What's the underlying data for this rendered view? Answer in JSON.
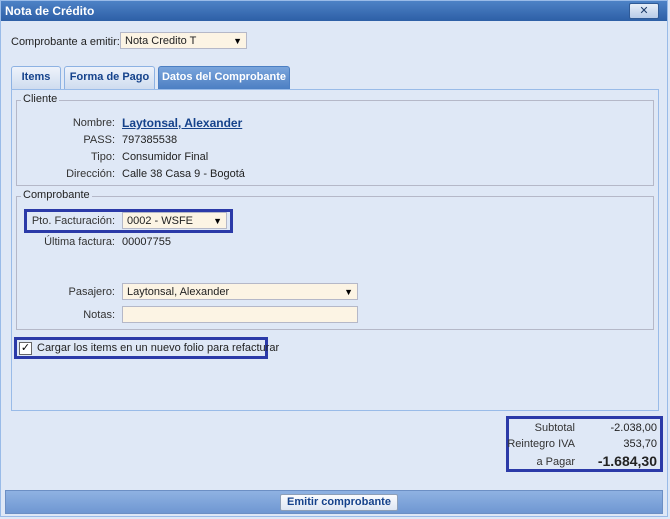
{
  "window": {
    "title": "Nota de Crédito",
    "close_label": "✕"
  },
  "comprobante_emitir": {
    "label": "Comprobante a emitir:",
    "value": "Nota Credito T"
  },
  "tabs": [
    {
      "label": "Items",
      "active": false
    },
    {
      "label": "Forma de Pago",
      "active": false
    },
    {
      "label": "Datos del Comprobante",
      "active": true
    }
  ],
  "cliente": {
    "legend": "Cliente",
    "nombre_label": "Nombre:",
    "nombre": "Laytonsal, Alexander",
    "pass_label": "PASS:",
    "pass": "797385538",
    "tipo_label": "Tipo:",
    "tipo": "Consumidor Final",
    "direccion_label": "Dirección:",
    "direccion": "Calle 38 Casa 9 - Bogotá"
  },
  "comprobante": {
    "legend": "Comprobante",
    "pto_label": "Pto. Facturación:",
    "pto_value": "0002 - WSFE",
    "ultima_label": "Última factura:",
    "ultima_value": "00007755",
    "pasajero_label": "Pasajero:",
    "pasajero_value": "Laytonsal, Alexander",
    "notas_label": "Notas:",
    "notas_value": ""
  },
  "cargar_items": {
    "label": "Cargar los items en un nuevo folio para refacturar",
    "checked": true,
    "mark": "✓"
  },
  "totals": {
    "subtotal_label": "Subtotal",
    "subtotal": "-2.038,00",
    "reintegro_label": "Reintegro IVA",
    "reintegro": "353,70",
    "pagar_label": "a Pagar",
    "pagar": "-1.684,30"
  },
  "footer": {
    "emit_label": "Emitir comprobante"
  },
  "colors": {
    "highlight": "#2b3aa8",
    "input_bg": "#fcf4e4",
    "link": "#15428b"
  },
  "icons": {
    "dropdown": "chevron-down-icon",
    "close": "close-icon",
    "check": "checkmark-icon"
  }
}
